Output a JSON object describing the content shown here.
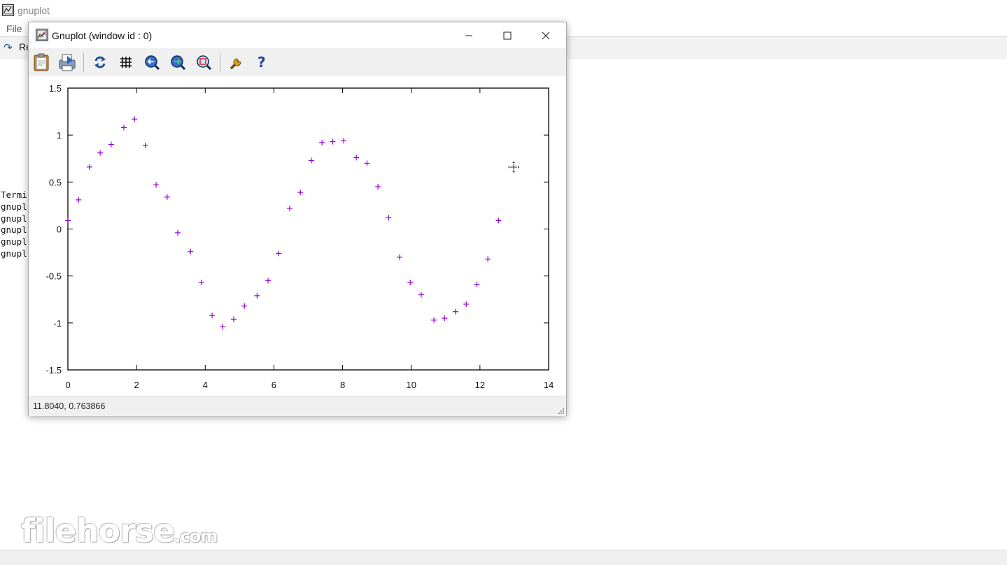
{
  "background_app": {
    "title": "gnuplot",
    "menu": [
      "File"
    ],
    "toolbar_label": "Re",
    "console_lines": [
      "Termi",
      "gnupl",
      "gnupl",
      "gnupl",
      "gnupl",
      "gnupl"
    ],
    "watermark": {
      "main": "filehorse",
      "suffix": ".com"
    }
  },
  "plot_window": {
    "title": "Gnuplot (window id : 0)",
    "toolbar": {
      "icons": [
        "clipboard-icon",
        "print-icon",
        "replot-icon",
        "grid-icon",
        "zoom-previous-icon",
        "zoom-next-icon",
        "unzoom-icon",
        "options-icon",
        "help-icon"
      ]
    },
    "status": "11.8040,  0.763866"
  },
  "chart_data": {
    "type": "scatter",
    "title": "",
    "xlabel": "",
    "ylabel": "",
    "xlim": [
      0,
      14
    ],
    "ylim": [
      -1.5,
      1.5
    ],
    "xticks": [
      "0",
      "2",
      "4",
      "6",
      "8",
      "10",
      "12",
      "14"
    ],
    "yticks": [
      "1.5",
      "1",
      "0.5",
      "0",
      "-0.5",
      "-1",
      "-1.5"
    ],
    "xtick_values": [
      0,
      2,
      4,
      6,
      8,
      10,
      12,
      14
    ],
    "ytick_values": [
      1.5,
      1,
      0.5,
      0,
      -0.5,
      -1,
      -1.5
    ],
    "point_color": "#9400d3",
    "marker": "plus",
    "series": [
      {
        "points": [
          [
            0.0,
            0.09
          ],
          [
            0.31,
            0.31
          ],
          [
            0.63,
            0.66
          ],
          [
            0.94,
            0.81
          ],
          [
            1.26,
            0.9
          ],
          [
            1.63,
            1.08
          ],
          [
            1.94,
            1.17
          ],
          [
            2.26,
            0.89
          ],
          [
            2.57,
            0.47
          ],
          [
            2.89,
            0.34
          ],
          [
            3.2,
            -0.04
          ],
          [
            3.57,
            -0.24
          ],
          [
            3.89,
            -0.57
          ],
          [
            4.2,
            -0.92
          ],
          [
            4.51,
            -1.04
          ],
          [
            4.83,
            -0.96
          ],
          [
            5.14,
            -0.82
          ],
          [
            5.51,
            -0.71
          ],
          [
            5.83,
            -0.55
          ],
          [
            6.14,
            -0.26
          ],
          [
            6.46,
            0.22
          ],
          [
            6.77,
            0.39
          ],
          [
            7.09,
            0.73
          ],
          [
            7.4,
            0.92
          ],
          [
            7.71,
            0.93
          ],
          [
            8.03,
            0.94
          ],
          [
            8.4,
            0.76
          ],
          [
            8.71,
            0.7
          ],
          [
            9.03,
            0.45
          ],
          [
            9.34,
            0.12
          ],
          [
            9.66,
            -0.3
          ],
          [
            9.97,
            -0.57
          ],
          [
            10.29,
            -0.7
          ],
          [
            10.66,
            -0.97
          ],
          [
            10.97,
            -0.95
          ],
          [
            11.29,
            -0.88
          ],
          [
            11.6,
            -0.8
          ],
          [
            11.91,
            -0.59
          ],
          [
            12.23,
            -0.32
          ],
          [
            12.54,
            0.09
          ]
        ]
      }
    ]
  }
}
